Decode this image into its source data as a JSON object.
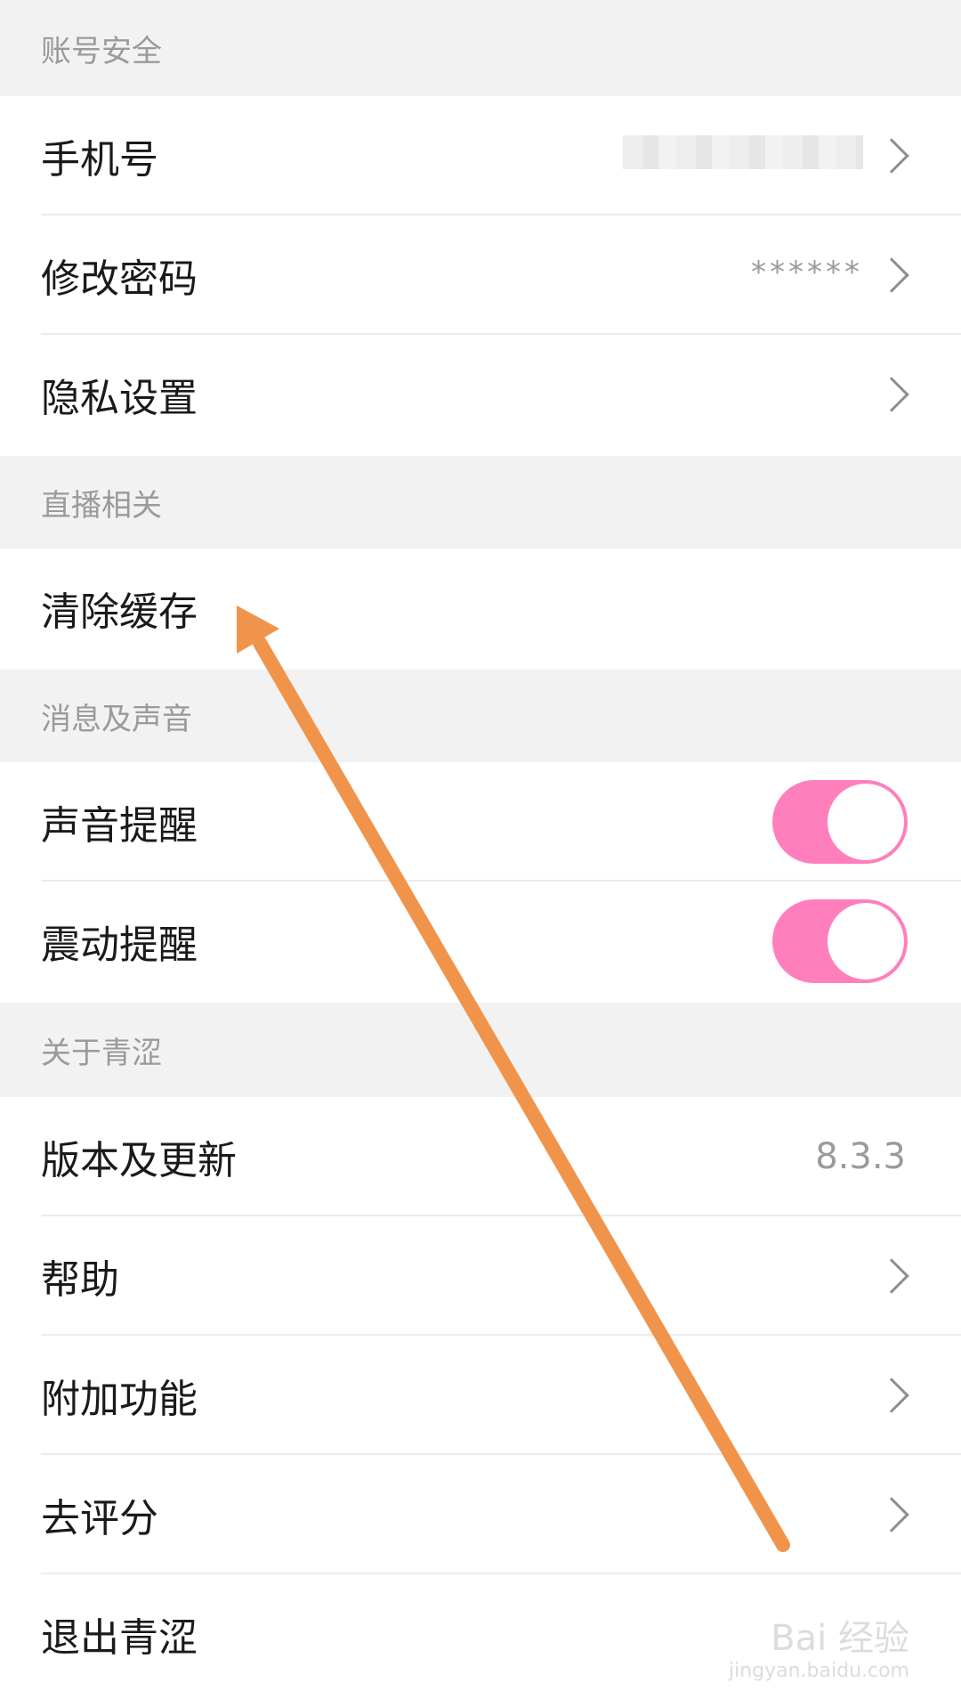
{
  "sections": {
    "account": {
      "title": "账号安全",
      "items": {
        "phone": {
          "label": "手机号"
        },
        "password": {
          "label": "修改密码",
          "value": "******"
        },
        "privacy": {
          "label": "隐私设置"
        }
      }
    },
    "live": {
      "title": "直播相关",
      "items": {
        "cache": {
          "label": "清除缓存"
        }
      }
    },
    "messages": {
      "title": "消息及声音",
      "items": {
        "sound": {
          "label": "声音提醒",
          "enabled": true
        },
        "vibrate": {
          "label": "震动提醒",
          "enabled": true
        }
      }
    },
    "about": {
      "title": "关于青涩",
      "items": {
        "version": {
          "label": "版本及更新",
          "value": "8.3.3"
        },
        "help": {
          "label": "帮助"
        },
        "extras": {
          "label": "附加功能"
        },
        "rate": {
          "label": "去评分"
        },
        "logout": {
          "label": "退出青涩"
        }
      }
    }
  },
  "colors": {
    "toggle_on": "#ff7fbc",
    "arrow": "#f0944c",
    "header_bg": "#f2f2f2"
  },
  "watermark": {
    "main": "Bai 经验",
    "sub": "jingyan.baidu.com"
  }
}
